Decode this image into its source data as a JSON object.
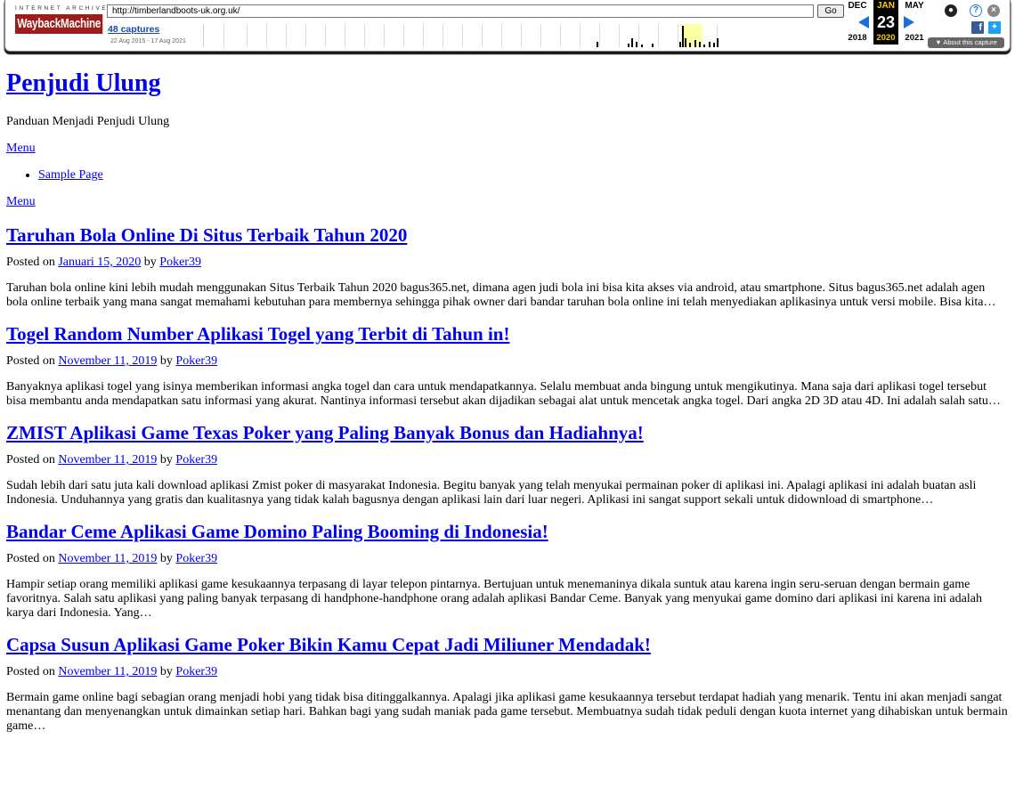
{
  "wayback": {
    "logo_top": "INTERNET ARCHIVE",
    "logo_main": "WaybackMachine",
    "url": "http://timberlandboots-uk.org.uk/",
    "go_label": "Go",
    "captures": "48 captures",
    "date_range": "22 Aug 2015 - 17 Aug 2021",
    "prev": {
      "month": "DEC",
      "year": "2018"
    },
    "current": {
      "month": "JAN",
      "day": "23",
      "year": "2020"
    },
    "next": {
      "month": "MAY",
      "year": "2021"
    },
    "about": "About this capture",
    "icons": [
      "user-icon",
      "help-icon",
      "close-icon",
      "facebook-icon",
      "twitter-icon"
    ]
  },
  "site": {
    "title": "Penjudi Ulung",
    "description": "Panduan Menjadi Penjudi Ulung",
    "menu_toggle": "Menu",
    "menu_items": [
      "Sample Page"
    ],
    "menu_toggle_2": "Menu"
  },
  "posts": [
    {
      "title": "Taruhan Bola Online Di Situs Terbaik Tahun 2020",
      "posted_on": "Posted on",
      "date": "Januari 15, 2020",
      "by": "by",
      "author": "Poker39",
      "excerpt": "Taruhan bola online kini lebih mudah menggunakan Situs Terbaik Tahun 2020 bagus365.net, dimana agen judi bola ini bisa kita akses via android, atau smartphone. Situs bagus365.net adalah agen bola online terbaik yang mana sangat memahami kebutuhan para membernya sehingga pihak owner dari bandar taruhan bola online ini telah menyediakan aplikasinya untuk versi mobile. Bisa kita…"
    },
    {
      "title": "Togel Random Number Aplikasi Togel yang Terbit di Tahun in!",
      "posted_on": "Posted on",
      "date": "November 11, 2019",
      "by": "by",
      "author": "Poker39",
      "excerpt": "  Banyaknya aplikasi togel yang isinya memberikan informasi angka togel dan cara untuk mendapatkannya. Selalu membuat anda bingung untuk mengikutinya. Mana saja dari aplikasi togel tersebut bisa membantu anda mendapatkan satu informasi yang akurat. Nantinya informasi tersebut akan dijadikan sebagai alat untuk mencetak angka togel. Dari angka 2D 3D atau 4D. Ini adalah salah satu…"
    },
    {
      "title": "ZMIST Aplikasi Game Texas Poker yang Paling Banyak Bonus dan Hadiahnya!",
      "posted_on": "Posted on",
      "date": "November 11, 2019",
      "by": "by",
      "author": "Poker39",
      "excerpt": "  Sudah lebih dari satu juta kali download aplikasi Zmist poker di masyarakat Indonesia. Begitu banyak yang telah menyukai permainan poker di aplikasi ini. Apalagi aplikasi ini adalah buatan asli Indonesia. Unduhannya yang gratis dan kualitasnya yang tidak kalah bagusnya dengan aplikasi lain dari luar negeri. Aplikasi ini sangat support sekali untuk didownload di smartphone…"
    },
    {
      "title": "Bandar Ceme Aplikasi Game Domino Paling Booming di Indonesia!",
      "posted_on": "Posted on",
      "date": "November 11, 2019",
      "by": "by",
      "author": "Poker39",
      "excerpt": "  Hampir setiap orang memiliki aplikasi game kesukaannya terpasang di layar telepon pintarnya. Bertujuan untuk menemaninya dikala suntuk atau karena ingin seru-seruan dengan bermain game favoritnya. Salah satu aplikasi yang paling banyak terpasang di handphone-handphone orang adalah aplikasi Bandar Ceme. Banyak yang menyukai game domino dari aplikasi ini karena ini adalah karya dari Indonesia. Yang…"
    },
    {
      "title": "Capsa Susun Aplikasi Game Poker Bikin Kamu Cepat Jadi Miliuner Mendadak!",
      "posted_on": "Posted on",
      "date": "November 11, 2019",
      "by": "by",
      "author": "Poker39",
      "excerpt": "  Bermain game online bagi sebagian orang menjadi hobi yang tidak bisa ditinggalkannya. Apalagi jika aplikasi game kesukaannya tersebut terdapat hadiah yang menarik. Tentu ini akan menjadi sangat menantang dan menyenangkan untuk dimainkan setiap hari. Bahkan bagi yang sudah maniak pada game tersebut. Membuatnya sudah tidak peduli dengan kuota internet yang dihabiskan untuk bermain game…"
    }
  ]
}
